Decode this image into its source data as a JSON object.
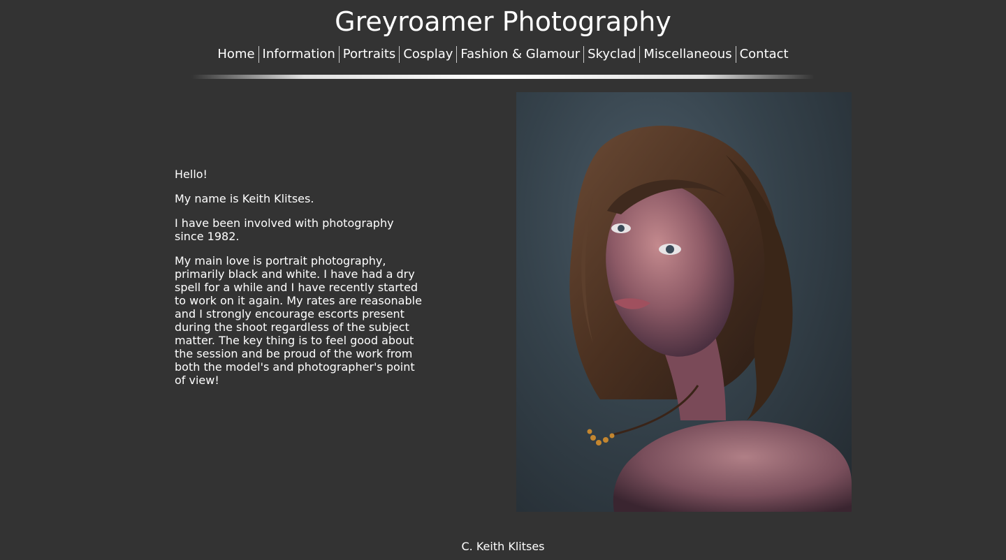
{
  "site": {
    "title": "Greyroamer Photography"
  },
  "nav": {
    "items": [
      {
        "label": "Home"
      },
      {
        "label": "Information"
      },
      {
        "label": "Portraits"
      },
      {
        "label": "Cosplay"
      },
      {
        "label": "Fashion & Glamour"
      },
      {
        "label": "Skyclad"
      },
      {
        "label": "Miscellaneous"
      },
      {
        "label": "Contact"
      }
    ]
  },
  "intro": {
    "greeting": "Hello!",
    "name_line": "My name is Keith Klitses.",
    "history": "I have been involved with photography since 1982.",
    "description": "My main love is portrait photography, primarily black and white. I have had a dry spell for a while and I have recently started to work on it again. My rates are reasonable and I strongly encourage escorts present during the shoot regardless of the subject matter. The key thing is to feel good about the session and be proud of the work from both the model's and photographer's point of view!"
  },
  "footer": {
    "copyright": "C. Keith Klitses"
  },
  "colors": {
    "background": "#333333",
    "text": "#ffffff"
  }
}
